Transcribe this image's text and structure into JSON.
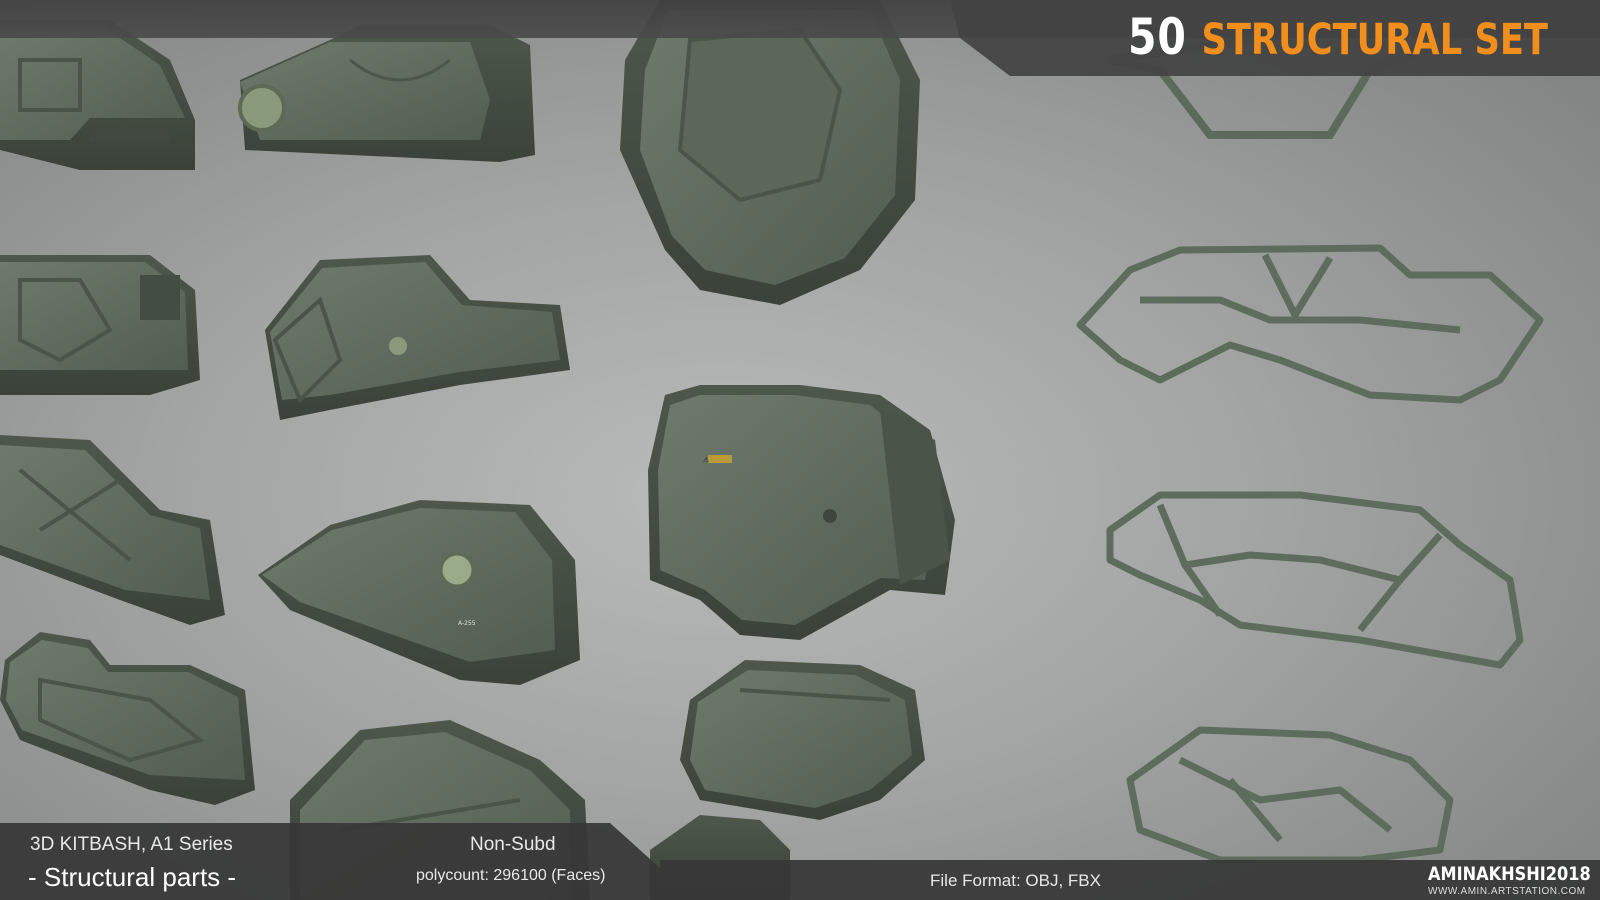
{
  "header": {
    "count": "50",
    "title": "STRUCTURAL SET"
  },
  "footer": {
    "series": "3D KITBASH,  A1 Series",
    "category": "- Structural parts -",
    "subd": "Non-Subd",
    "polycount": "polycount: 296100  (Faces)",
    "file_format": "File Format:   OBJ, FBX",
    "brand": "AMINAKHSHI2018",
    "website": "WWW.AMIN.ARTSTATION.COM"
  },
  "colors": {
    "accent": "#f28f1c",
    "part_green": "#5f6b5e",
    "background": "#a2a4a4",
    "strip": "#373737"
  },
  "decals": {
    "warning_label": "⚠",
    "part_code": "A-255"
  }
}
